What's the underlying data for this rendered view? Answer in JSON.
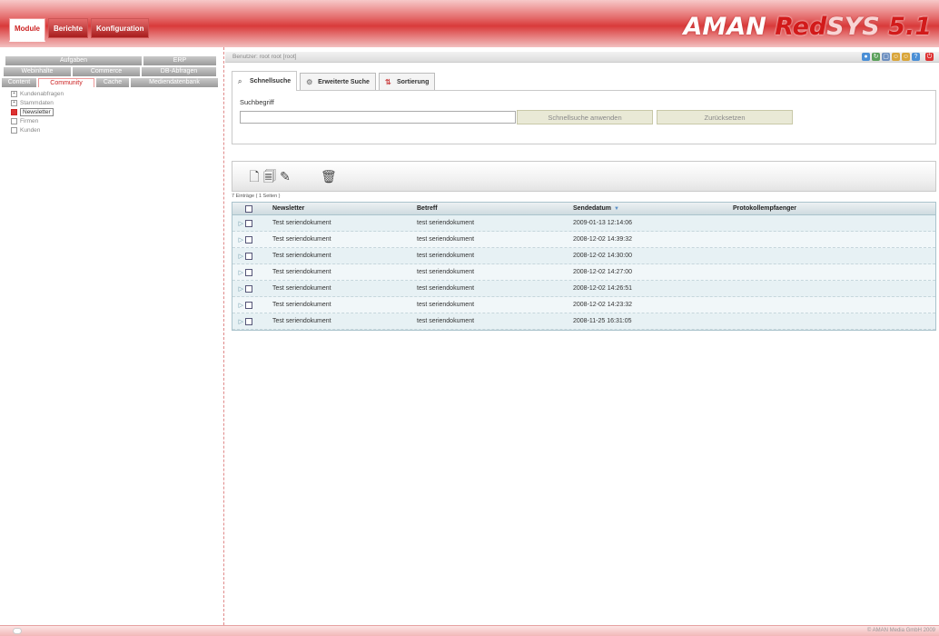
{
  "header": {
    "tabs": [
      "Module",
      "Berichte",
      "Konfiguration"
    ],
    "active_tab": 0,
    "logo": {
      "part1": "AMAN",
      "part2": "Red",
      "part3": "SYS",
      "part4": "5.1"
    }
  },
  "sidebar": {
    "tab_rows": [
      [
        "Aufgaben",
        "ERP"
      ],
      [
        "Webinhalte",
        "Commerce",
        "DB-Abfragen"
      ],
      [
        "Content",
        "Community",
        "Cache",
        "Mediendatenbank"
      ]
    ],
    "active_tab": "Community",
    "tree": [
      {
        "label": "Kundenabfragen",
        "icon": "plus-box-icon",
        "selected": false
      },
      {
        "label": "Stammdaten",
        "icon": "plus-box-icon",
        "selected": false
      },
      {
        "label": "Newsletter",
        "icon": "folder-icon",
        "selected": true
      },
      {
        "label": "Firmen",
        "icon": "leaf-box-icon",
        "selected": false
      },
      {
        "label": "Kunden",
        "icon": "leaf-box-icon",
        "selected": false
      }
    ]
  },
  "userbar": {
    "user": "Benutzer: root root [root]",
    "icons": [
      {
        "name": "globe-icon",
        "color": "#4a8fd6"
      },
      {
        "name": "refresh-icon",
        "color": "#5aa05a"
      },
      {
        "name": "window-icon",
        "color": "#6c8fc0"
      },
      {
        "name": "user-icon",
        "color": "#d9a53a"
      },
      {
        "name": "users-icon",
        "color": "#d9a53a"
      },
      {
        "name": "help-icon",
        "color": "#4a8fd6"
      },
      {
        "name": "logout-icon",
        "color": "#d33"
      }
    ]
  },
  "search": {
    "tabs": [
      {
        "label": "Schnellsuche",
        "icon": "magnifier-icon"
      },
      {
        "label": "Erweiterte Suche",
        "icon": "advanced-search-icon"
      },
      {
        "label": "Sortierung",
        "icon": "sort-icon"
      }
    ],
    "active_tab": 0,
    "field_label": "Suchbegriff",
    "value": "",
    "placeholder": "",
    "apply_label": "Schnellsuche anwenden",
    "reset_label": "Zurücksetzen"
  },
  "toolbar": {
    "icons": [
      "new-document-icon",
      "copy-document-icon",
      "edit-document-icon",
      "delete-icon"
    ]
  },
  "list": {
    "count": "7 Einträge ( 1 Seiten )",
    "columns": [
      "Newsletter",
      "Betreff",
      "Sendedatum",
      "Protokollempfaenger"
    ],
    "sort_column": "Sendedatum",
    "rows": [
      [
        "Test seriendokument",
        "test seriendokument",
        "2009-01-13 12:14:06",
        ""
      ],
      [
        "Test seriendokument",
        "test seriendokument",
        "2008-12-02 14:39:32",
        ""
      ],
      [
        "Test seriendokument",
        "test seriendokument",
        "2008-12-02 14:30:00",
        ""
      ],
      [
        "Test seriendokument",
        "test seriendokument",
        "2008-12-02 14:27:00",
        ""
      ],
      [
        "Test seriendokument",
        "test seriendokument",
        "2008-12-02 14:26:51",
        ""
      ],
      [
        "Test seriendokument",
        "test seriendokument",
        "2008-12-02 14:23:32",
        ""
      ],
      [
        "Test seriendokument",
        "test seriendokument",
        "2008-11-25 16:31:05",
        ""
      ]
    ]
  },
  "footer": {
    "copyright": "© AMAN Media GmbH 2009"
  }
}
